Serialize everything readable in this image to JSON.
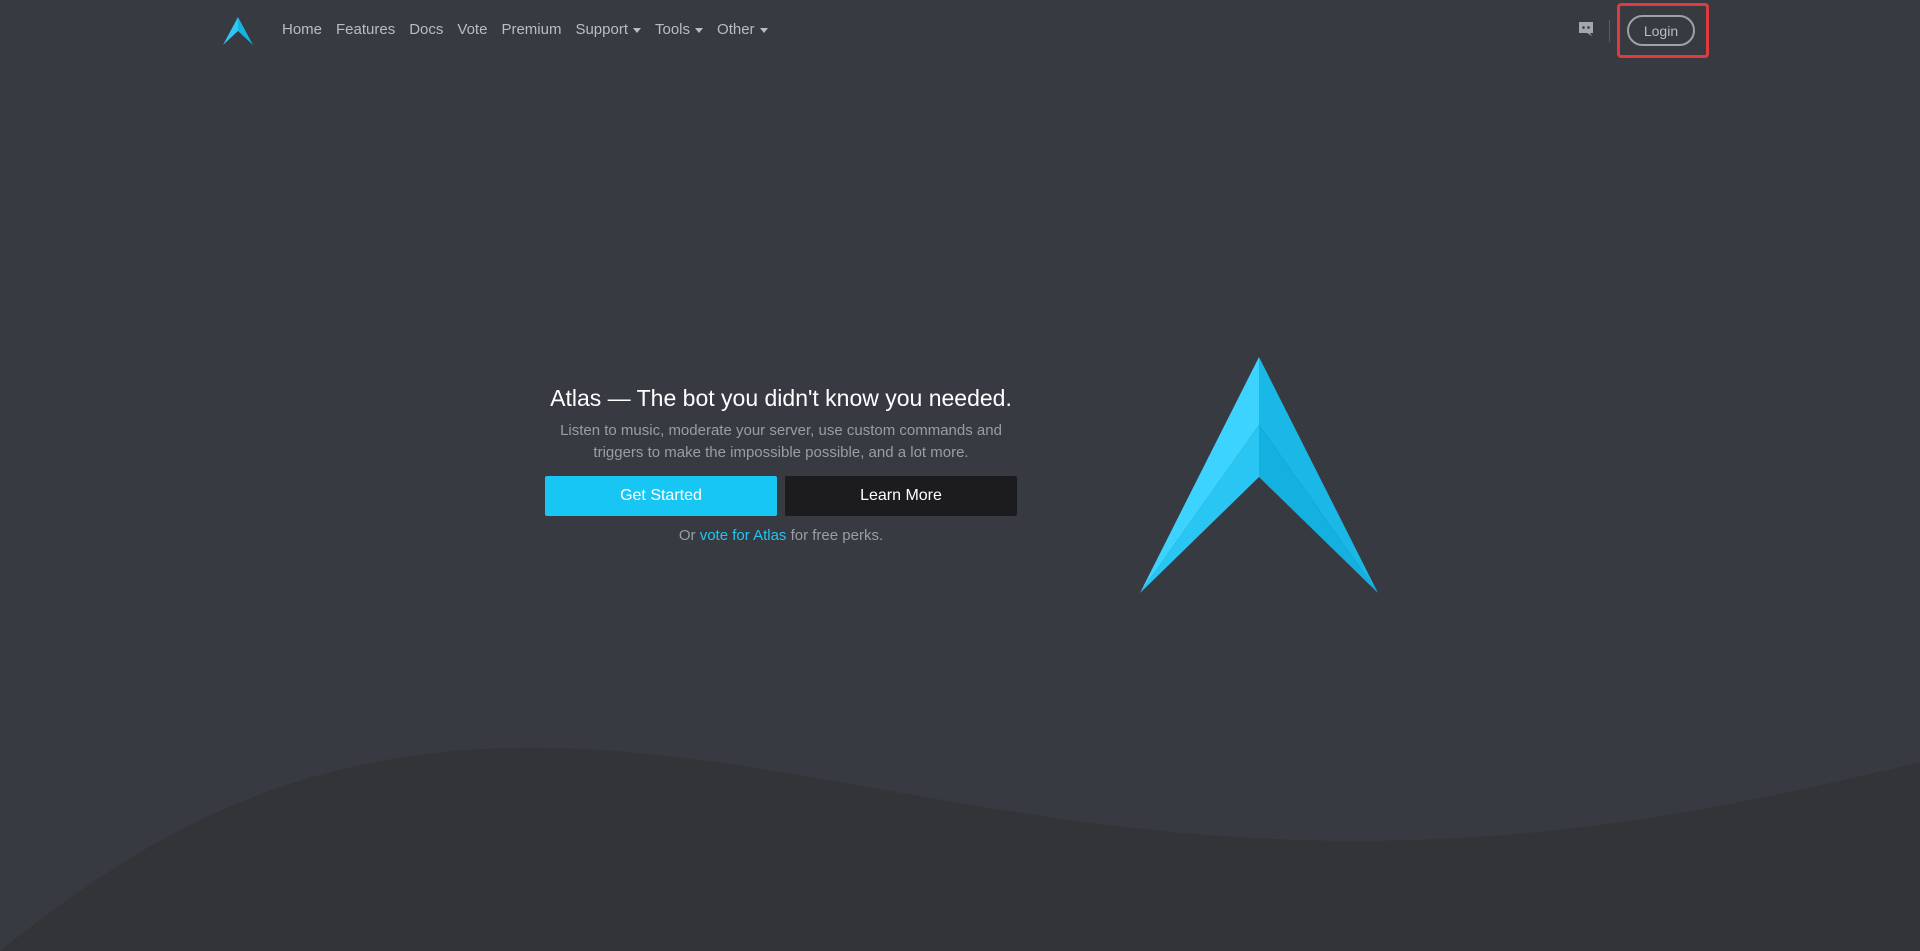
{
  "nav": {
    "logo_icon": "atlas-logo-icon",
    "links": [
      {
        "label": "Home",
        "dropdown": false
      },
      {
        "label": "Features",
        "dropdown": false
      },
      {
        "label": "Docs",
        "dropdown": false
      },
      {
        "label": "Vote",
        "dropdown": false
      },
      {
        "label": "Premium",
        "dropdown": false
      },
      {
        "label": "Support",
        "dropdown": true
      },
      {
        "label": "Tools",
        "dropdown": true
      },
      {
        "label": "Other",
        "dropdown": true
      }
    ],
    "discord_icon": "discord-icon",
    "login_label": "Login"
  },
  "hero": {
    "title": "Atlas — The bot you didn't know you needed.",
    "subtitle_line1": "Listen to music, moderate your server, use custom commands and",
    "subtitle_line2": "triggers to make the impossible possible, and a lot more.",
    "primary_button": "Get Started",
    "secondary_button": "Learn More",
    "vote_prefix": "Or",
    "vote_link": "vote for Atlas",
    "vote_suffix": "for free perks."
  },
  "colors": {
    "background": "#383a42",
    "wave": "#333438",
    "accent": "#17c6f3",
    "dark_button": "#1c1c1e",
    "highlight": "#e0393e"
  }
}
